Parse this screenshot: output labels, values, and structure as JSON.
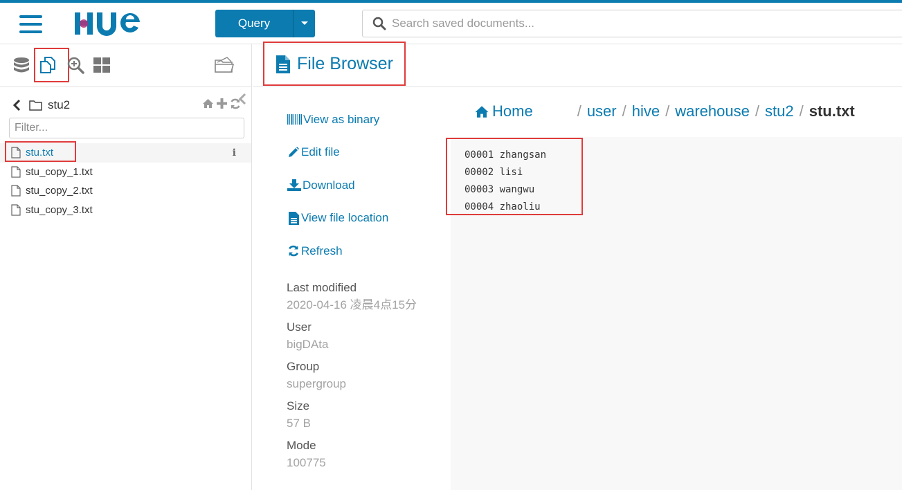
{
  "app": {
    "logo_text": "HUE",
    "brand_color": "#0b7bb0",
    "highlight_color": "#e03b3b"
  },
  "topbar": {
    "query_label": "Query",
    "search_placeholder": "Search saved documents..."
  },
  "left_panel": {
    "tabs": [
      "database-icon",
      "files-icon",
      "search-icon",
      "grid-icon"
    ],
    "current_folder": "stu2",
    "filter_placeholder": "Filter...",
    "files": [
      {
        "name": "stu.txt",
        "active": true
      },
      {
        "name": "stu_copy_1.txt",
        "active": false
      },
      {
        "name": "stu_copy_2.txt",
        "active": false
      },
      {
        "name": "stu_copy_3.txt",
        "active": false
      }
    ]
  },
  "main": {
    "title": "File Browser",
    "actions": [
      {
        "label": "View as binary",
        "icon": "barcode-icon"
      },
      {
        "label": "Edit file",
        "icon": "pencil-icon"
      },
      {
        "label": "Download",
        "icon": "download-icon"
      },
      {
        "label": "View file location",
        "icon": "file-icon"
      },
      {
        "label": "Refresh",
        "icon": "refresh-icon"
      }
    ],
    "metadata": {
      "last_modified_label": "Last modified",
      "last_modified": "2020-04-16 凌晨4点15分",
      "user_label": "User",
      "user": "bigDAta",
      "group_label": "Group",
      "group": "supergroup",
      "size_label": "Size",
      "size": "57 B",
      "mode_label": "Mode",
      "mode": "100775"
    },
    "breadcrumb": {
      "home": "Home",
      "parts": [
        "user",
        "hive",
        "warehouse",
        "stu2"
      ],
      "current": "stu.txt"
    },
    "file_content": [
      "00001 zhangsan",
      "00002 lisi",
      "00003 wangwu",
      "00004 zhaoliu"
    ]
  }
}
